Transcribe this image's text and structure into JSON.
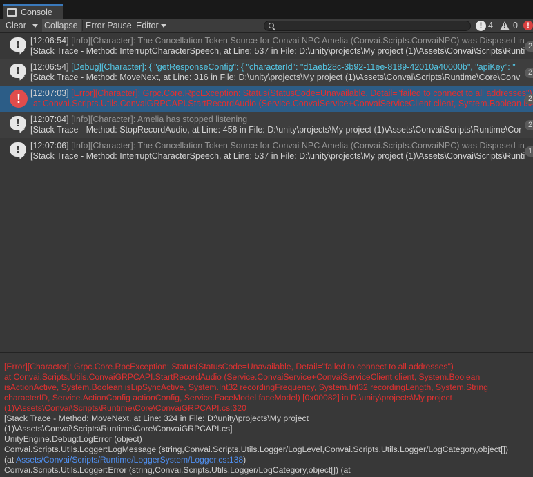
{
  "window": {
    "tab_label": "Console"
  },
  "toolbar": {
    "clear_label": "Clear",
    "collapse_label": "Collapse",
    "error_pause_label": "Error Pause",
    "editor_label": "Editor",
    "search_value": "",
    "info_count": "4",
    "warning_count": "0"
  },
  "entries": [
    {
      "level": "info",
      "time": "[12:06:54]",
      "message": "[Info][Character]: The Cancellation Token Source for Convai NPC Amelia (Convai.Scripts.ConvaiNPC) was Disposed in",
      "trace": "[Stack Trace - Method: InterruptCharacterSpeech, at Line: 537 in File: D:\\unity\\projects\\My project (1)\\Assets\\Convai\\Scripts\\Runti",
      "badge": "2"
    },
    {
      "level": "debug",
      "time": "[12:06:54]",
      "message": "[Debug][Character]: { \"getResponseConfig\": { \"characterId\": \"d1aeb28c-3b92-11ee-8189-42010a40000b\", \"apiKey\": \"",
      "trace": "[Stack Trace - Method: MoveNext, at Line: 316 in File: D:\\unity\\projects\\My project (1)\\Assets\\Convai\\Scripts\\Runtime\\Core\\Conv",
      "badge": "2"
    },
    {
      "level": "error",
      "time": "[12:07:03]",
      "message": "[Error][Character]: Grpc.Core.RpcException: Status(StatusCode=Unavailable, Detail=\"failed to connect to all addresses\")",
      "trace": "at Convai.Scripts.Utils.ConvaiGRPCAPI.StartRecordAudio (Service.ConvaiService+ConvaiServiceClient client, System.Boolean isA",
      "badge": "2"
    },
    {
      "level": "info",
      "time": "[12:07:04]",
      "message": "[Info][Character]: Amelia has stopped listening",
      "trace": "[Stack Trace - Method: StopRecordAudio, at Line: 458 in File: D:\\unity\\projects\\My project (1)\\Assets\\Convai\\Scripts\\Runtime\\Cor",
      "badge": "2"
    },
    {
      "level": "info",
      "time": "[12:07:06]",
      "message": "[Info][Character]: The Cancellation Token Source for Convai NPC Amelia (Convai.Scripts.ConvaiNPC) was Disposed in",
      "trace": "[Stack Trace - Method: InterruptCharacterSpeech, at Line: 537 in File: D:\\unity\\projects\\My project (1)\\Assets\\Convai\\Scripts\\Runti",
      "badge": "1"
    }
  ],
  "detail": {
    "lines": [
      "[Error][Character]: Grpc.Core.RpcException: Status(StatusCode=Unavailable, Detail=\"failed to connect to all addresses\")",
      "  at Convai.Scripts.Utils.ConvaiGRPCAPI.StartRecordAudio (Service.ConvaiService+ConvaiServiceClient client, System.Boolean",
      "isActionActive, System.Boolean isLipSyncActive, System.Int32 recordingFrequency, System.Int32 recordingLength, System.String",
      "characterID, Service.ActionConfig actionConfig, Service.FaceModel faceModel) [0x00082] in D:\\unity\\projects\\My project",
      "(1)\\Assets\\Convai\\Scripts\\Runtime\\Core\\ConvaiGRPCAPI.cs:320",
      "[Stack Trace - Method: MoveNext, at Line: 324 in File: D:\\unity\\projects\\My project",
      "(1)\\Assets\\Convai\\Scripts\\Runtime\\Core\\ConvaiGRPCAPI.cs]",
      "UnityEngine.Debug:LogError (object)",
      "Convai.Scripts.Utils.Logger:LogMessage (string,Convai.Scripts.Utils.Logger/LogLevel,Convai.Scripts.Utils.Logger/LogCategory,object[])",
      "Convai.Scripts.Utils.Logger:Error (string,Convai.Scripts.Utils.Logger/LogCategory,object[]) (at"
    ],
    "at_prefix": "(at ",
    "link_text": "Assets/Convai/Scripts/Runtime/LoggerSystem/Logger.cs:138",
    "at_suffix": ")"
  },
  "colors": {
    "selected_row": "#2c5d87",
    "error_text": "#e03030",
    "debug_text": "#55c8e6",
    "link": "#4f8ff0"
  }
}
